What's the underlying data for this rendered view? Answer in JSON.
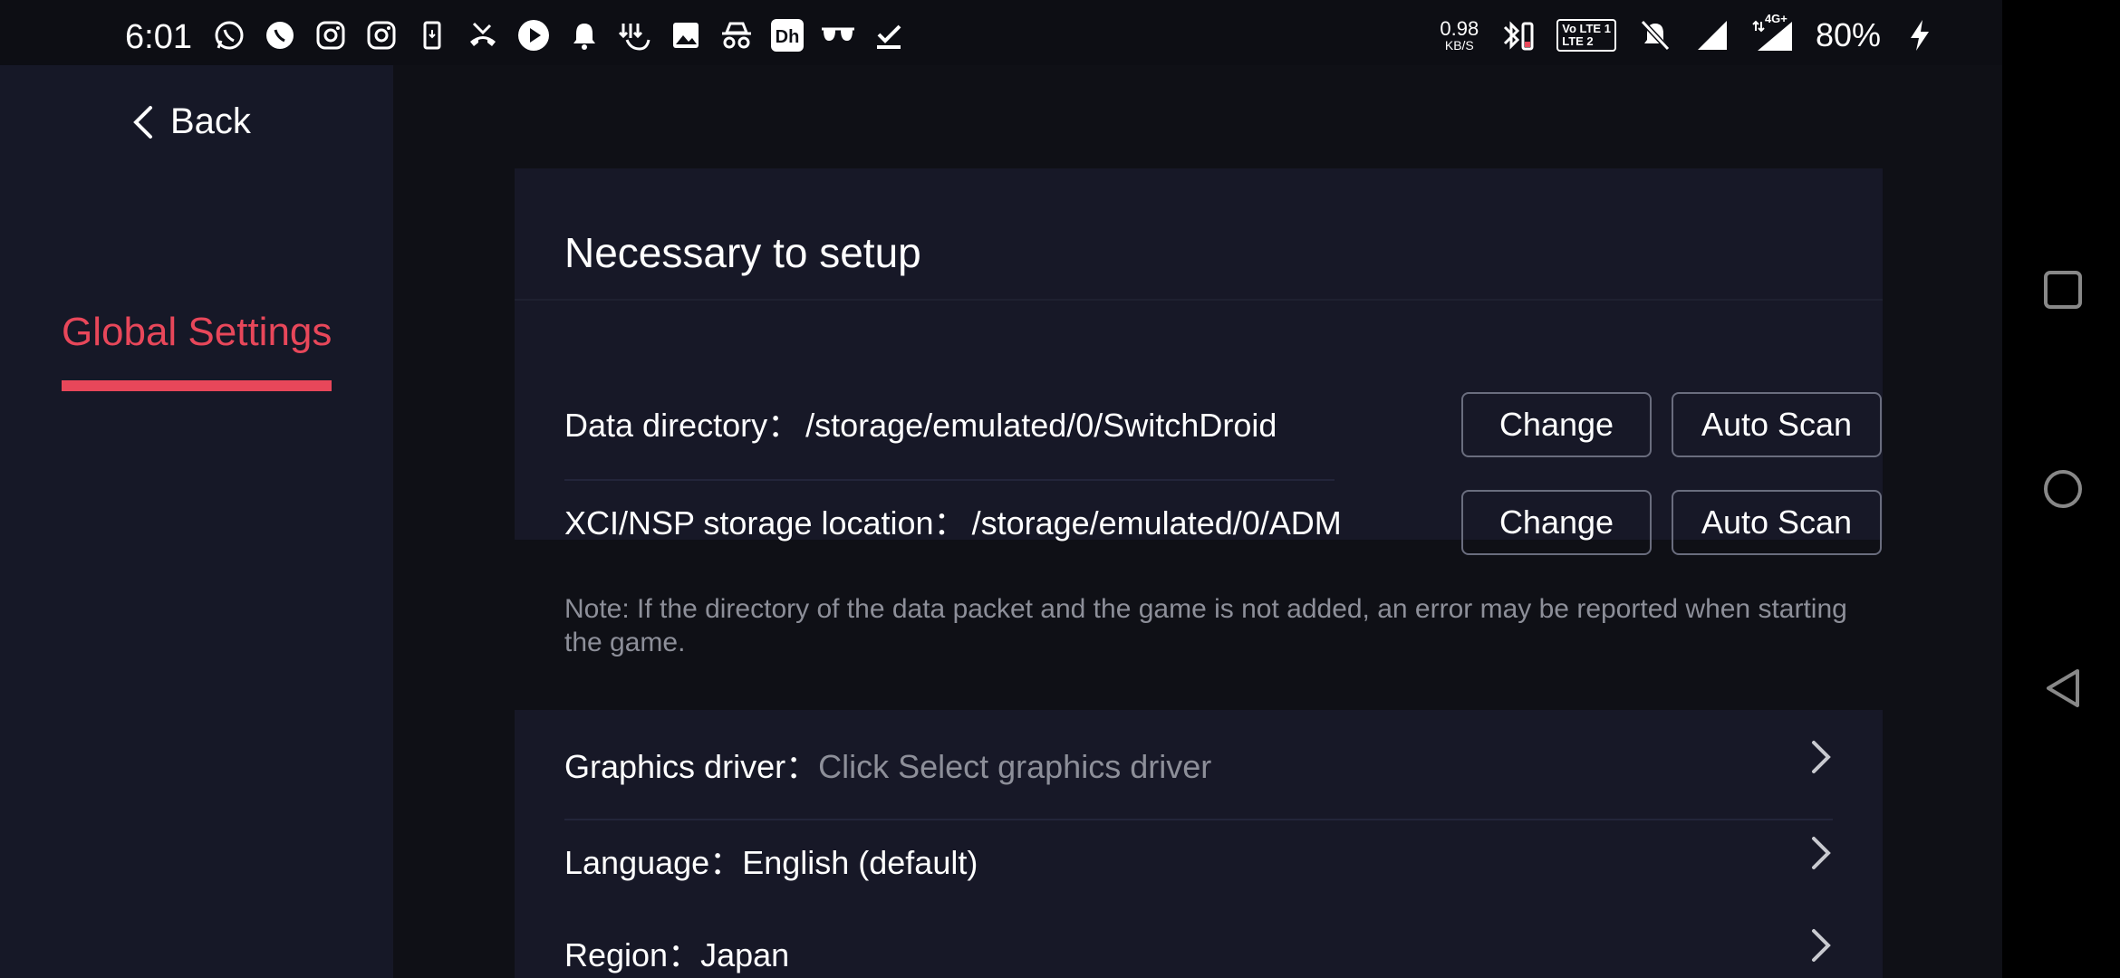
{
  "status_bar": {
    "time": "6:01",
    "left_icons": [
      "whatsapp-icon",
      "whatsapp-business-icon",
      "instagram-icon",
      "instagram-icon",
      "download-phone-icon",
      "missed-call-icon",
      "play-icon",
      "bell-icon",
      "gesture-download-icon",
      "image-icon",
      "incognito-icon",
      "app-icon",
      "sunglasses-icon",
      "check-download-icon"
    ],
    "speed_value": "0.98",
    "speed_unit": "KB/S",
    "volte_top": "Vo LTE 1",
    "volte_bottom": "LTE 2",
    "network": "4G+",
    "battery": "80%"
  },
  "sidebar": {
    "back_label": "Back",
    "items": [
      {
        "label": "Global Settings",
        "active": true
      }
    ]
  },
  "setup_card": {
    "title": "Necessary to setup",
    "rows": [
      {
        "label": "Data directory：",
        "value": "/storage/emulated/0/SwitchDroid",
        "change_label": "Change",
        "scan_label": "Auto Scan"
      },
      {
        "label": "XCI/NSP storage location：",
        "value": "/storage/emulated/0/ADM",
        "change_label": "Change",
        "scan_label": "Auto Scan"
      }
    ]
  },
  "note": "Note: If the directory of the data packet and the game is not added, an error may be reported when starting the game.",
  "settings": [
    {
      "label": "Graphics driver：",
      "value": "Click Select graphics driver",
      "placeholder": true
    },
    {
      "label": "Language：",
      "value": "English (default)",
      "placeholder": false
    },
    {
      "label": "Region：",
      "value": "Japan",
      "placeholder": false
    }
  ],
  "colors": {
    "accent": "#e8475a",
    "background": "#0f1016",
    "card": "#171827",
    "sidebar": "#161827"
  }
}
